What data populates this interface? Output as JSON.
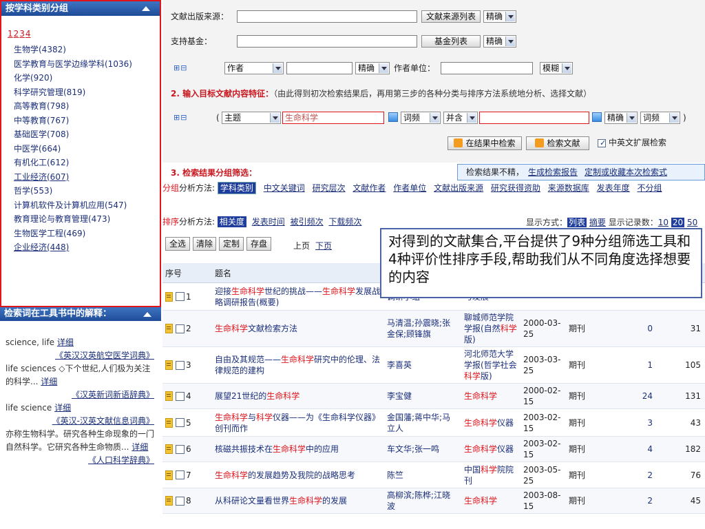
{
  "sidebar": {
    "category_panel_title": "按学科类别分组",
    "category_pages": [
      "1",
      "2",
      "3",
      "4"
    ],
    "categories": [
      "生物学(4382)",
      "医学教育与医学边缘学科(1036)",
      "化学(920)",
      "科学研究管理(819)",
      "高等教育(798)",
      "中等教育(767)",
      "基础医学(708)",
      "中医学(664)",
      "有机化工(612)",
      "工业经济(607)",
      "哲学(553)",
      "计算机软件及计算机应用(547)",
      "教育理论与教育管理(473)",
      "生物医学工程(469)",
      "企业经济(448)"
    ],
    "dict_panel_title": "检索词在工具书中的解释：",
    "dict_entries": [
      {
        "text": "science, life",
        "more": "详细",
        "source": "《英汉汉英航空医学词典》"
      },
      {
        "text": "life sciences ◇下个世纪,人们极为关注的科学...",
        "more": "详细",
        "source": "《汉英新词新语辞典》"
      },
      {
        "text": "life science",
        "more": "详细",
        "source": "《英汉-汉英文献信息词典》"
      },
      {
        "text": "亦称生物科学。研究各种生命现象的一门自然科学。它研究各种生命物质...",
        "more": "详细",
        "source": "《人口科学辞典》"
      }
    ]
  },
  "search": {
    "source_label": "文献出版来源：",
    "source_list_btn": "文献来源列表",
    "match_exact": "精确",
    "fund_label": "支持基金：",
    "fund_list_btn": "基金列表",
    "plusminus": "⊞⊟",
    "author_field": "作者",
    "author_unit_label": "作者单位：",
    "fuzzy": "模糊",
    "step2_title": "2. 输入目标文献内容特征：",
    "step2_hint": "（由此得到初次检索结果后，再用第三步的各种分类与排序方法系统地分析、选择文献）",
    "field_subject": "主题",
    "subject_value": "生命科学",
    "freq": "词频",
    "and_op": "并含",
    "search_in_results": "在结果中检索",
    "search_btn": "检索文献",
    "cn_en_expand": "中英文扩展检索",
    "step3_title": "3. 检索结果分组筛选：",
    "not_good_label": "检索结果不精，",
    "gen_report": "生成检索报告",
    "custom_save": "定制或收藏本次检索式"
  },
  "group_bar": {
    "label_prefix": "分组",
    "label_rest": "分析方法:",
    "active": "学科类别",
    "options": [
      "中文关键词",
      "研究层次",
      "文献作者",
      "作者单位",
      "文献出版来源",
      "研究获得资助",
      "来源数据库",
      "发表年度",
      "不分组"
    ]
  },
  "sort_bar": {
    "label_prefix": "排序",
    "label_rest": "分析方法:",
    "active": "相关度",
    "options": [
      "发表时间",
      "被引频次",
      "下载频次"
    ]
  },
  "display_mode": {
    "label": "显示方式：",
    "active": "列表",
    "alt": "摘要",
    "count_label": "显示记录数：",
    "counts": [
      "10",
      "20",
      "50"
    ],
    "active_count": "20"
  },
  "toolbar": {
    "select_all": "全选",
    "clear": "清除",
    "custom": "定制",
    "save": "存盘",
    "prev": "上页",
    "next": "下页"
  },
  "table": {
    "headers": [
      "序号",
      "题名",
      "",
      "",
      "",
      "",
      "",
      ""
    ],
    "rows": [
      {
        "no": "1",
        "title_pre": "迎接",
        "kw": "生命科学",
        "title_post": "世纪的挑战——",
        "kw2": "生命科学",
        "title_post2": "发展战略调研报告(概要)",
        "author": "调研小组",
        "src_pre": "",
        "src_kw": "",
        "src_post": "与发展",
        "date": "",
        "type": "",
        "cite": "",
        "dl": ""
      },
      {
        "no": "2",
        "title_pre": "",
        "kw": "生命科学",
        "title_post": "文献检索方法",
        "kw2": "",
        "title_post2": "",
        "author": "马清温;孙震晓;张金保;顾锋旗",
        "src_pre": "聊城师范学院学报(自然",
        "src_kw": "科学",
        "src_post": "版)",
        "date": "2000-03-25",
        "type": "期刊",
        "cite": "0",
        "dl": "31"
      },
      {
        "no": "3",
        "title_pre": "自由及其规范——",
        "kw": "生命科学",
        "title_post": "研究中的伦理、法律规范的建构",
        "kw2": "",
        "title_post2": "",
        "author": "李喜英",
        "src_pre": "河北师范大学学报(哲学社会",
        "src_kw": "科学",
        "src_post": "版)",
        "date": "2003-03-25",
        "type": "期刊",
        "cite": "1",
        "dl": "105"
      },
      {
        "no": "4",
        "title_pre": "展望21世纪的",
        "kw": "生命科学",
        "title_post": "",
        "kw2": "",
        "title_post2": "",
        "author": "李宝健",
        "src_pre": "",
        "src_kw": "生命科学",
        "src_post": "",
        "date": "2000-02-15",
        "type": "期刊",
        "cite": "24",
        "dl": "131"
      },
      {
        "no": "5",
        "title_pre": "",
        "kw": "生命科学",
        "title_post": "与",
        "kw2": "科学",
        "title_post2": "仪器——为《生命科学仪器》创刊而作",
        "author": "金国藩;蒋中华;马立人",
        "src_pre": "",
        "src_kw": "生命科学",
        "src_post": "仪器",
        "date": "2003-02-15",
        "type": "期刊",
        "cite": "3",
        "dl": "43"
      },
      {
        "no": "6",
        "title_pre": "核磁共振技术在",
        "kw": "生命科学",
        "title_post": "中的应用",
        "kw2": "",
        "title_post2": "",
        "author": "车文华;张一鸣",
        "src_pre": "",
        "src_kw": "生命科学",
        "src_post": "仪器",
        "date": "2003-02-15",
        "type": "期刊",
        "cite": "4",
        "dl": "182"
      },
      {
        "no": "7",
        "title_pre": "",
        "kw": "生命科学",
        "title_post": "的发展趋势及我院的战略思考",
        "kw2": "",
        "title_post2": "",
        "author": "陈竺",
        "src_pre": "中国",
        "src_kw": "科学",
        "src_post": "院院刊",
        "date": "2003-05-25",
        "type": "期刊",
        "cite": "2",
        "dl": "76"
      },
      {
        "no": "8",
        "title_pre": "从科研论文量看世界",
        "kw": "生命科学",
        "title_post": "的发展",
        "kw2": "",
        "title_post2": "",
        "author": "高柳滨;陈桦;江晓波",
        "src_pre": "",
        "src_kw": "生命科学",
        "src_post": "",
        "date": "2003-08-15",
        "type": "期刊",
        "cite": "2",
        "dl": "45"
      }
    ]
  },
  "callout": {
    "text": "对得到的文献集合,平台提供了9种分组筛选工具和4种评价性排序手段,帮助我们从不同角度选择想要的内容"
  },
  "colors": {
    "red_accent": "#e0141b",
    "link_blue": "#1b2f7a",
    "panel_blue": "#1f4c98",
    "highlight_blue": "#1f3d9c"
  }
}
